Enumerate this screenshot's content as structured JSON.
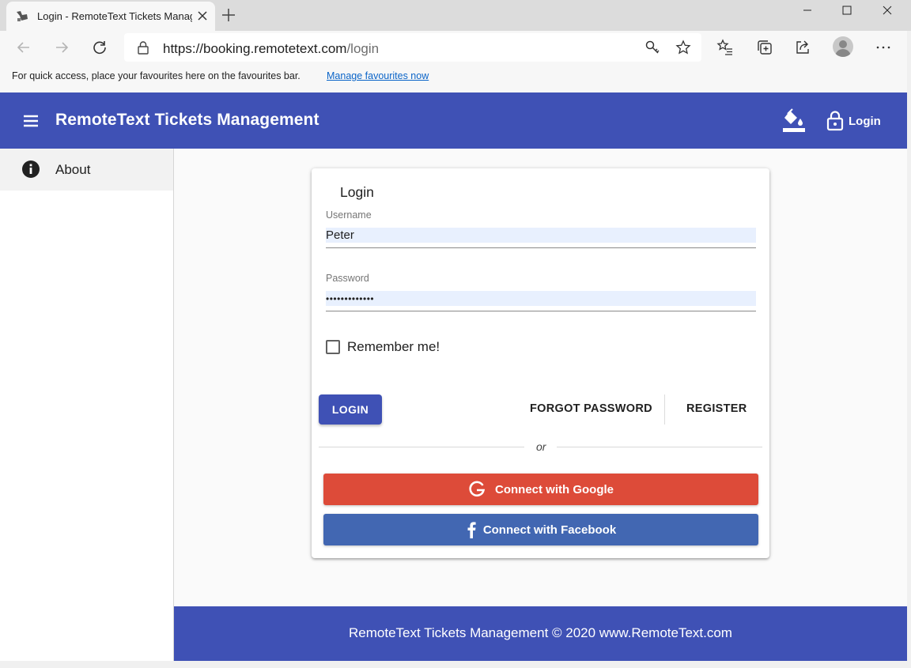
{
  "browser": {
    "tab_title": "Login - RemoteText Tickets Management",
    "url_host": "https://booking.remotetext.com",
    "url_path": "/login",
    "favourites_text": "For quick access, place your favourites here on the favourites bar.",
    "favourites_link": "Manage favourites now"
  },
  "app": {
    "title": "RemoteText Tickets Management",
    "login_label": "Login",
    "primary_color": "#3f51b5"
  },
  "sidebar": {
    "items": [
      {
        "label": "About",
        "icon": "info-icon"
      }
    ]
  },
  "login_card": {
    "title": "Login",
    "username_label": "Username",
    "username_value": "Peter",
    "password_label": "Password",
    "password_value": "•••••••••••••",
    "remember_label": "Remember me!",
    "remember_checked": false,
    "login_button": "LOGIN",
    "forgot_button": "FORGOT PASSWORD",
    "register_button": "REGISTER",
    "or_text": "or",
    "google_button": "Connect with Google",
    "facebook_button": "Connect with Facebook",
    "google_color": "#dd4b39",
    "facebook_color": "#4267b2"
  },
  "footer": {
    "text": "RemoteText Tickets Management © 2020 www.RemoteText.com"
  }
}
